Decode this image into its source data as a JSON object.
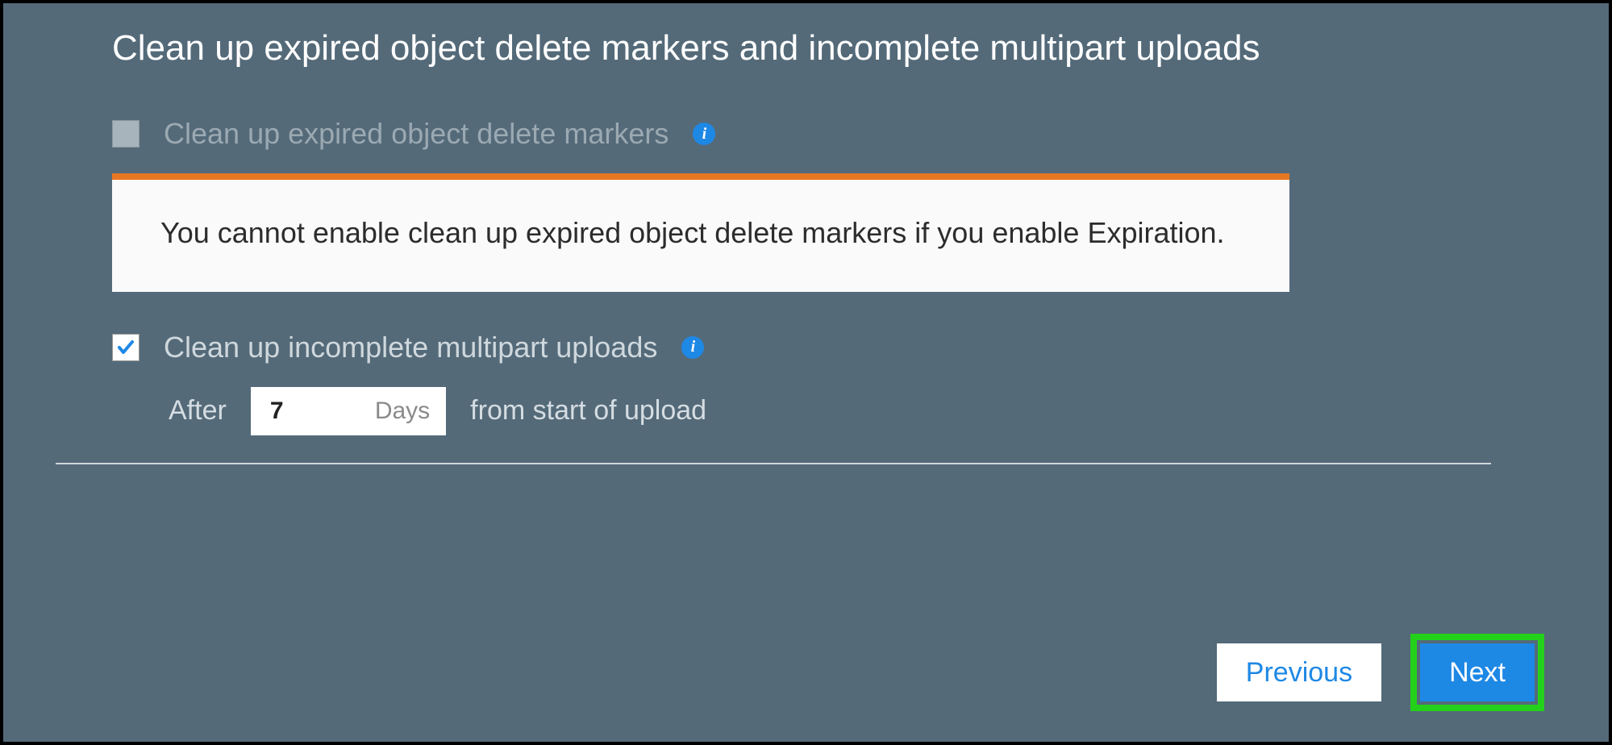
{
  "section": {
    "title": "Clean up expired object delete markers and incomplete multipart uploads"
  },
  "options": {
    "expiredMarkers": {
      "label": "Clean up expired object delete markers",
      "checked": false,
      "disabled": true
    },
    "multipartUploads": {
      "label": "Clean up incomplete multipart uploads",
      "checked": true,
      "afterPrefix": "After",
      "daysValue": "7",
      "daysUnit": "Days",
      "afterSuffix": "from start of upload"
    }
  },
  "alert": {
    "message": "You cannot enable clean up expired object delete markers if you enable Expiration."
  },
  "footer": {
    "previousLabel": "Previous",
    "nextLabel": "Next"
  },
  "colors": {
    "panelBg": "#546a79",
    "alertAccent": "#e87722",
    "primary": "#1e88e5",
    "highlight": "#24d11a"
  }
}
